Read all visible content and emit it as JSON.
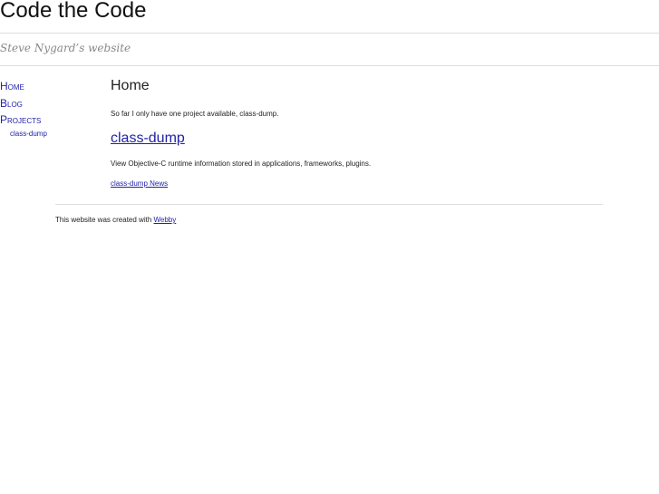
{
  "header": {
    "title": "Code the Code",
    "tagline": "Steve Nygard’s website"
  },
  "nav": {
    "items": [
      {
        "label": "Home"
      },
      {
        "label": "Blog"
      },
      {
        "label": "Projects"
      }
    ],
    "sub_items": [
      {
        "label": "class-dump"
      }
    ]
  },
  "main": {
    "heading": "Home",
    "intro": "So far I only have one project available, class-dump.",
    "project": {
      "title": "class-dump",
      "description": "View Objective-C runtime information stored in applications, frameworks, plugins.",
      "news_link": "class-dump News"
    }
  },
  "footer": {
    "text": "This website was created with ",
    "link": "Webby"
  }
}
